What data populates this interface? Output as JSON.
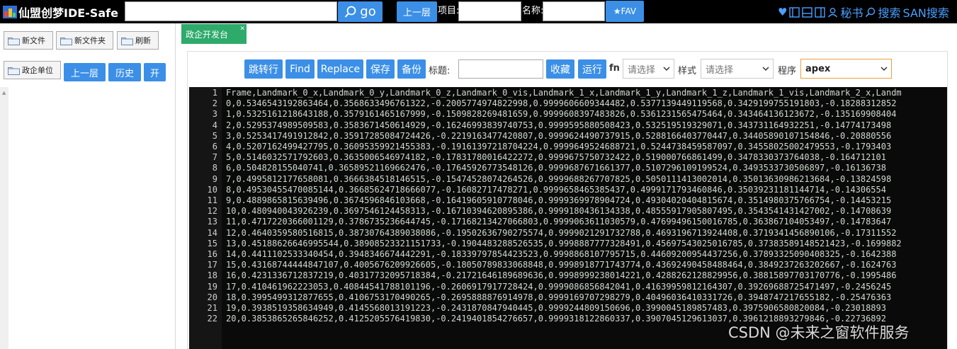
{
  "topbar": {
    "title": "仙盟创梦IDE-Safe",
    "search_value": "",
    "go_label": "go",
    "up_label": "上一层",
    "project_label": "项目:",
    "project_value": "",
    "name_label": "名称:",
    "name_value": "",
    "fav_label": "★FAV",
    "secretary_label": "秘书",
    "search_label": "搜索",
    "san_label": "SAN搜索"
  },
  "sidebar": {
    "new_file": "新文件",
    "new_folder": "新文件夹",
    "refresh": "刷新",
    "gov_unit": "政企单位",
    "up": "上一层",
    "history": "历史",
    "open": "开"
  },
  "tab": {
    "label": "政企开发台",
    "close": "✕"
  },
  "toolbar": {
    "goto_line": "跳转行",
    "find": "Find",
    "replace": "Replace",
    "save": "保存",
    "backup": "备份",
    "title_label": "标题:",
    "title_value": "",
    "collect": "收藏",
    "run": "运行",
    "fn_label": "fn",
    "fn_select": "请选择",
    "style_label": "样式",
    "style_select": "请选择",
    "program_label": "程序",
    "program_select": "apex"
  },
  "editor": {
    "line_numbers": [
      "1",
      "2",
      "3",
      "4",
      "5",
      "6",
      "7",
      "8",
      "9",
      "10",
      "11",
      "12",
      "13",
      "14",
      "15",
      "16",
      "17",
      "18",
      "19",
      "20",
      "21",
      "22"
    ],
    "lines": [
      "Frame,Landmark_0_x,Landmark_0_y,Landmark_0_z,Landmark_0_vis,Landmark_1_x,Landmark_1_y,Landmark_1_z,Landmark_1_vis,Landmark_2_x,Landm",
      "0,0.5346543192863464,0.3568633496761322,-0.2005774974822998,0.9999606609344482,0.5377139449119568,0.3429199755191803,-0.18288312852",
      "1,0.5325161218643188,0.3579161465167999,-0.1509828269481659,0.9999608397483826,0.5361231565475464,0.343464136123672,-0.135169908404",
      "2,0.5295374989509583,0.3583671450614929,-0.16246993839740753,0.9999595880508423,0.532519519329071,0.343731164932251,-0.14774173498",
      "3,0.5253417491912842,0.35917285084724426,-0.2219163477420807,0.9999624490737915,0.5288166403770447,0.34405890107154846,-0.20880556",
      "4,0.5207162499427795,0.36095359921455383,-0.19161397218704224,0.9999649524688721,0.5244738459587097,0.34558025002479553,-0.1793403",
      "5,0.5146032571792603,0.3635006546974182,-0.17831780016422272,0.9999675750732422,0.519000766861499,0.3478330373764038,-0.164712101",
      "6,0.504828155040741,0.36589521169662476,-0.17645926773548126,0.9999687671661377,0.5107296109199524,0.3493533730506897,-0.16136738",
      "7,0.4995812177658081,0.3666384518146515,-0.15474528074264526,0.9999688267707825,0.5050111413002014,0.35013630986213684,-0.13824598",
      "8,0.49530455470085144,0.36685624718666077,-0.16082717478271,0.9999658465385437,0.4999171793460846,0.35039231181144714,-0.14306554",
      "9,0.4889865815639496,0.3674596846103668,-0.16419605910778046,0.9999369978904724,0.49304020404815674,0.3514980375766754,-0.14453215",
      "10,0.480940043926239,0.3697546124458313,-0.16710394620895386,0.9999180436134338,0.48555917905807495,0.3543541431427002,-0.14708639",
      "11,0.4717220366001129,0.3786735236644745,-0.17168213427066803,0.9999063611030579,0.47699496150016785,0.363867104053497,-0.14783647",
      "12,0.4640359580516815,0.38730764389038086,-0.19502636790275574,0.9999021291732788,0.4693196713924408,0.3719341456890106,-0.17311552",
      "13,0.45188626646995544,0.38908523321151733,-0.1904483288526535,0.9998887777328491,0.45697543025016785,0.37383589148521423,-0.1699882",
      "14,0.4411102533340454,0.3948346674442291,-0.18339797854423523,0.9998868107795715,0.44609200954437256,0.37893325090408325,-0.1642388",
      "15,0.43168744444847107,0.4005676209926605,-0.18050789833068848,0.9998918771743774,0.43692490458488464,0.3849237263202667,-0.1624763",
      "16,0.4231336712837219,0.40317732095718384,-0.21721646189689636,0.9998999238014221,0.4288262128829956,0.38815897703170776,-0.1995486",
      "17,0.410461962223053,0.40844541788101196,-0.2606917917728424,0.9999086856842041,0.41639959812164307,0.39269688725471497,-0.2456245",
      "18,0.3995499312877655,0.4106753170490265,-0.2695888876914978,0.9999169707298279,0.40496036410331726,0.3948747217655182,-0.25476363",
      "19,0.3938519358634949,0.4145568013191223,-0.2431870847940445,0.9999244809150696,0.3990045189857483,0.3975906580820084,-0.23018893",
      "20,0.3853865265846252,0.4125205576419830,-0.2419401854276657,0.9999318122860337,0.3907045129613037,0.3961218893279846,-0.22736892"
    ]
  },
  "watermark": "CSDN @未来之窗软件服务",
  "colors": {
    "accent_blue": "#3b8fe6",
    "tab_green": "#2eaa6a",
    "editor_bg": "#0a0a0a",
    "select_orange": "#e8a23c"
  }
}
